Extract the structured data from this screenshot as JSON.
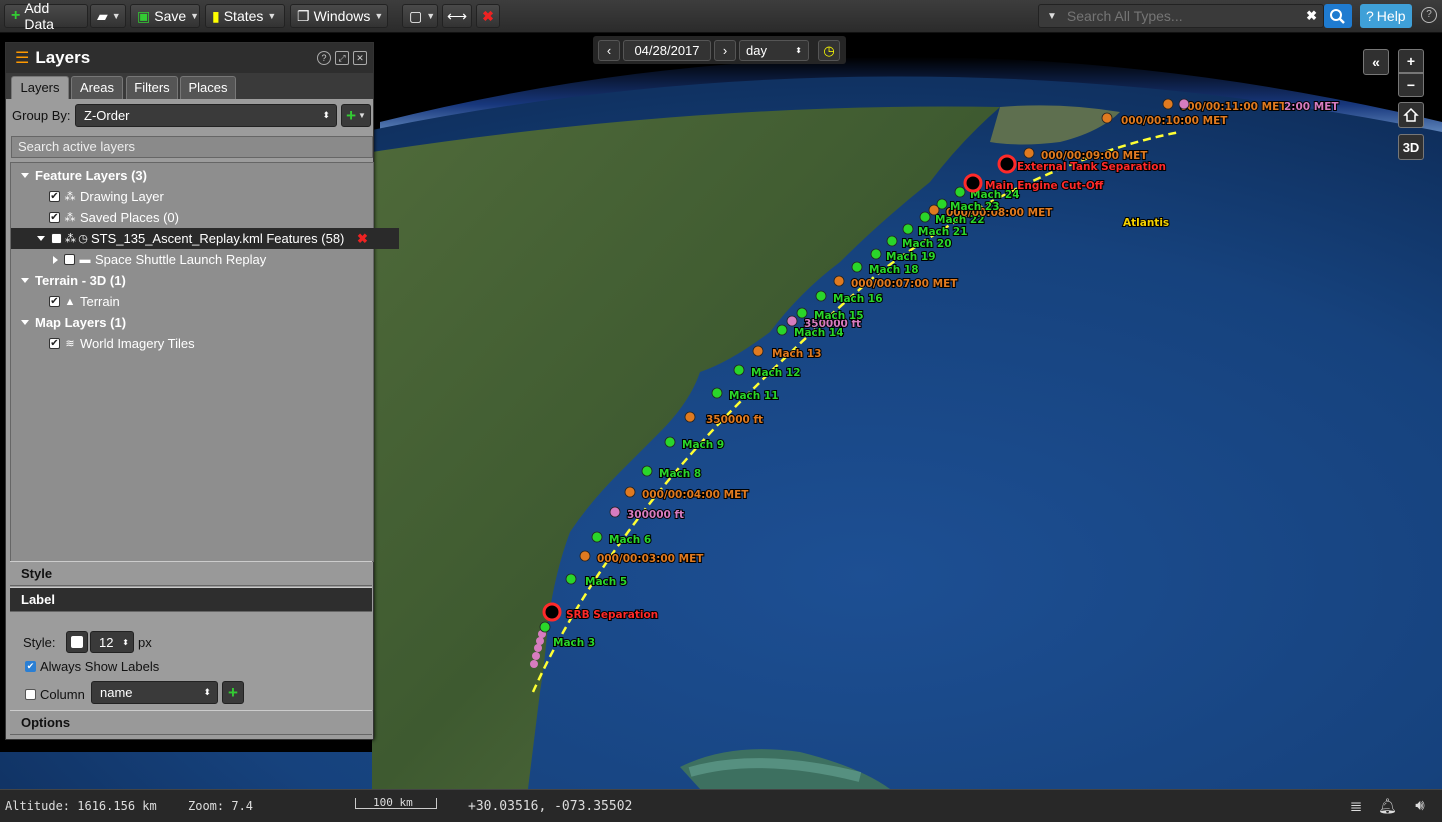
{
  "toolbar": {
    "add_data": "Add Data",
    "save": "Save",
    "states": "States",
    "windows": "Windows",
    "search_placeholder": "Search All Types...",
    "help": "Help"
  },
  "date_control": {
    "date": "04/28/2017",
    "interval": "day"
  },
  "layers_panel": {
    "title": "Layers",
    "tabs": [
      "Layers",
      "Areas",
      "Filters",
      "Places"
    ],
    "group_by_label": "Group By:",
    "group_by_value": "Z-Order",
    "search_placeholder": "Search active layers",
    "tree": [
      {
        "label": "Feature Layers (3)"
      },
      {
        "label": "Drawing Layer"
      },
      {
        "label": "Saved Places (0)"
      },
      {
        "label": "STS_135_Ascent_Replay.kml Features (58)"
      },
      {
        "label": "Space Shuttle Launch Replay"
      },
      {
        "label": "Terrain - 3D (1)"
      },
      {
        "label": "Terrain"
      },
      {
        "label": "Map Layers (1)"
      },
      {
        "label": "World Imagery Tiles"
      }
    ],
    "sections": {
      "style": "Style",
      "label": "Label",
      "options": "Options"
    },
    "label_settings": {
      "style_label": "Style:",
      "font_size": "12",
      "unit": "px",
      "always_show": "Always Show Labels",
      "always_show_checked": true,
      "column_label": "Column",
      "column_value": "name"
    }
  },
  "map_controls": {
    "collapse": "«",
    "zoom_in": "+",
    "zoom_out": "−",
    "view_3d": "3D"
  },
  "map_labels": {
    "ocean": "Atlantis",
    "markers": [
      "Mach 3",
      "SRB Separation",
      "Mach 5",
      "000/00:03:00 MET",
      "Mach 6",
      "300000 ft",
      "000/00:04:00 MET",
      "Mach 8",
      "Mach 9",
      "350000 ft",
      "Mach 11",
      "Mach 12",
      "Mach 13",
      "Mach 14",
      "350000 ft",
      "Mach 15",
      "Mach 16",
      "000/00:07:00 MET",
      "Mach 18",
      "Mach 19",
      "Mach 20",
      "Mach 21",
      "Mach 22",
      "000/00:08:00 MET",
      "Mach 23",
      "Mach 24",
      "Main Engine Cut-Off",
      "External Tank Separation",
      "000/00:09:00 MET",
      "000/00:10:00 MET",
      "000/00:11:00 MET",
      "2:00 MET"
    ]
  },
  "status_bar": {
    "altitude": "Altitude: 1616.156 km",
    "zoom": "Zoom: 7.4",
    "scale": "100 km",
    "coords": "+30.03516, -073.35502"
  },
  "colors": {
    "accent": "#1f7bd0",
    "green_marker": "#2ad62a",
    "orange_marker": "#e07a20",
    "pink_marker": "#d77cc0",
    "red_label": "#ff2a2a",
    "track": "#ffff33"
  }
}
